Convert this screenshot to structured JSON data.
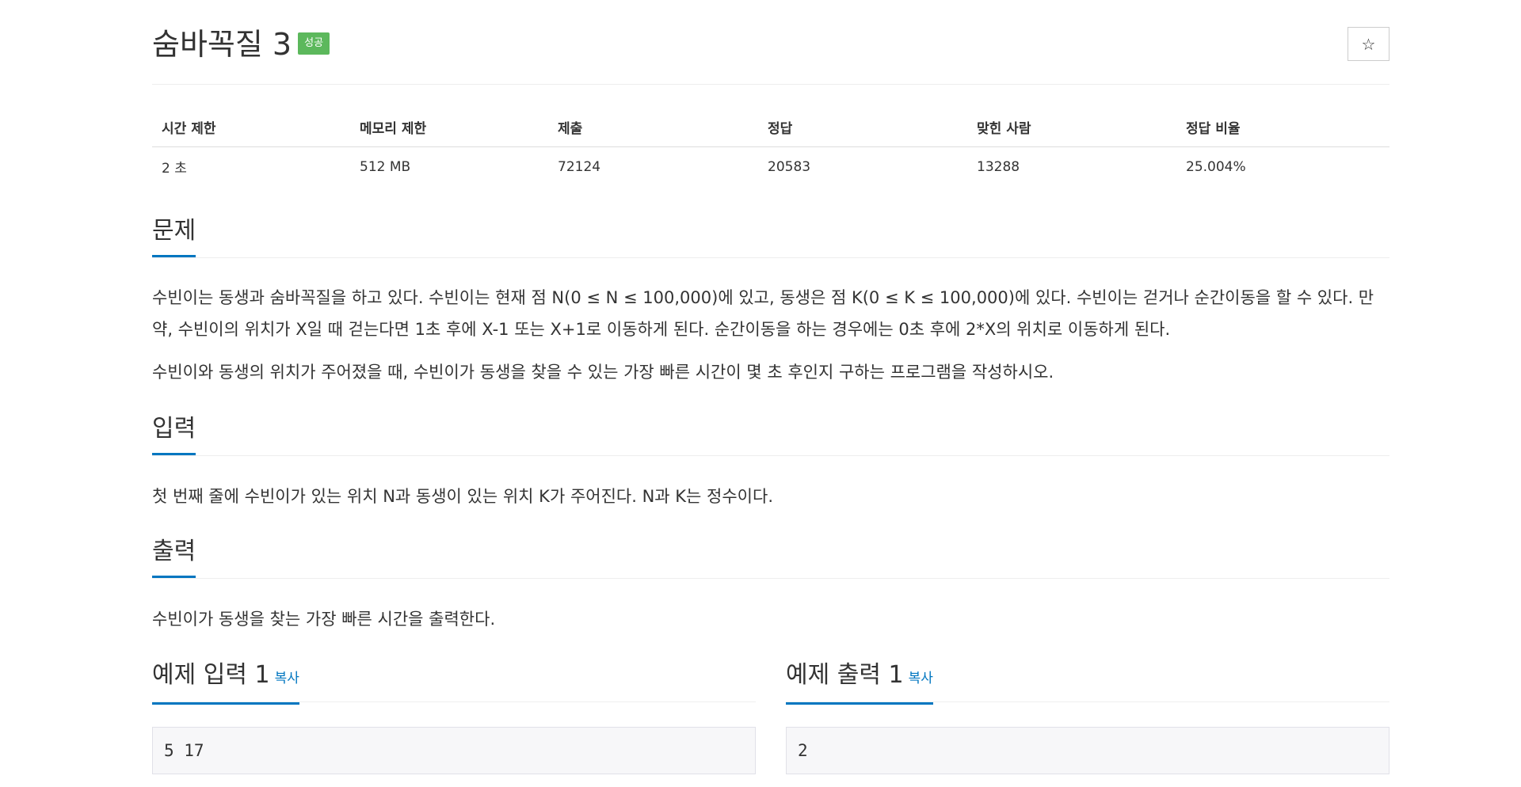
{
  "problem": {
    "title": "숨바꼭질 3",
    "badge": "성공",
    "star_icon": "☆"
  },
  "info_table": {
    "headers": [
      "시간 제한",
      "메모리 제한",
      "제출",
      "정답",
      "맞힌 사람",
      "정답 비율"
    ],
    "values": [
      "2 초",
      "512 MB",
      "72124",
      "20583",
      "13288",
      "25.004%"
    ]
  },
  "sections": {
    "description": {
      "heading": "문제",
      "paragraphs": [
        "수빈이는 동생과 숨바꼭질을 하고 있다. 수빈이는 현재 점 N(0 ≤ N ≤ 100,000)에 있고, 동생은 점 K(0 ≤ K ≤ 100,000)에 있다. 수빈이는 걷거나 순간이동을 할 수 있다. 만약, 수빈이의 위치가 X일 때 걷는다면 1초 후에 X-1 또는 X+1로 이동하게 된다. 순간이동을 하는 경우에는 0초 후에 2*X의 위치로 이동하게 된다.",
        "수빈이와 동생의 위치가 주어졌을 때, 수빈이가 동생을 찾을 수 있는 가장 빠른 시간이 몇 초 후인지 구하는 프로그램을 작성하시오."
      ]
    },
    "input": {
      "heading": "입력",
      "text": "첫 번째 줄에 수빈이가 있는 위치 N과 동생이 있는 위치 K가 주어진다. N과 K는 정수이다."
    },
    "output": {
      "heading": "출력",
      "text": "수빈이가 동생을 찾는 가장 빠른 시간을 출력한다."
    }
  },
  "samples": {
    "input": {
      "heading": "예제 입력 1",
      "copy_label": "복사",
      "content": "5 17"
    },
    "output": {
      "heading": "예제 출력 1",
      "copy_label": "복사",
      "content": "2"
    }
  },
  "colors": {
    "accent": "#0076c0",
    "success_badge": "#5cb85c"
  }
}
